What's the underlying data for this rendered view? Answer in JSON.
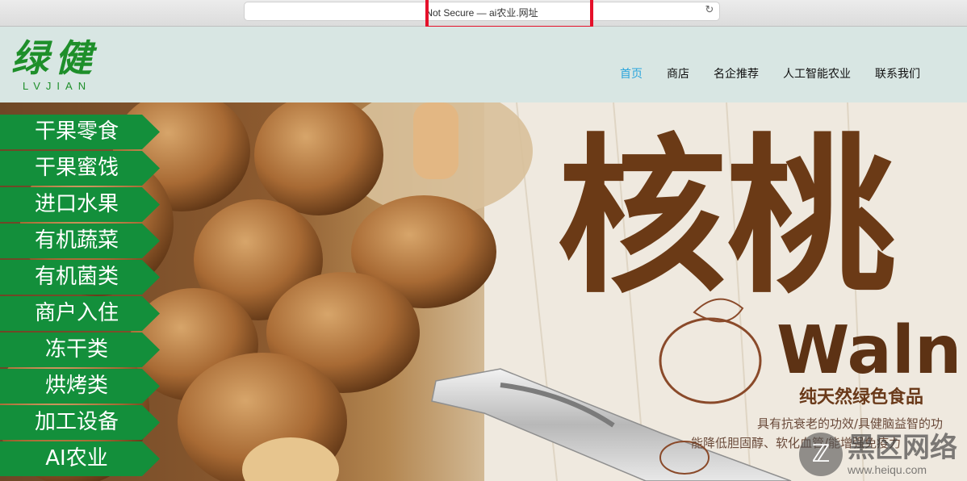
{
  "browser": {
    "address": "Not Secure — ai农业.网址"
  },
  "logo": {
    "chinese": "绿健",
    "english": "LVJIAN"
  },
  "nav": [
    {
      "label": "首页",
      "active": true
    },
    {
      "label": "商店",
      "active": false
    },
    {
      "label": "名企推荐",
      "active": false
    },
    {
      "label": "人工智能农业",
      "active": false
    },
    {
      "label": "联系我们",
      "active": false
    }
  ],
  "categories": [
    "干果零食",
    "干果蜜饯",
    "进口水果",
    "有机蔬菜",
    "有机菌类",
    "商户入住",
    "冻干类",
    "烘烤类",
    "加工设备",
    "AI农业"
  ],
  "banner": {
    "headline": "核桃",
    "english": "Waln",
    "tagline": "纯天然绿色食品",
    "desc_line1": "具有抗衰老的功效/具健脑益智的功",
    "desc_line2": "能降低胆固醇、软化血管/能增强免疫力"
  },
  "watermark": {
    "name": "黑区网络",
    "url": "www.heiqu.com"
  },
  "colors": {
    "accent_red": "#e5102a",
    "brand_green": "#1e8f2a",
    "menu_green": "#138f3b",
    "nav_active": "#2aa5dc",
    "header_bg": "#d8e6e3",
    "walnut_brown": "#6b3a16"
  }
}
